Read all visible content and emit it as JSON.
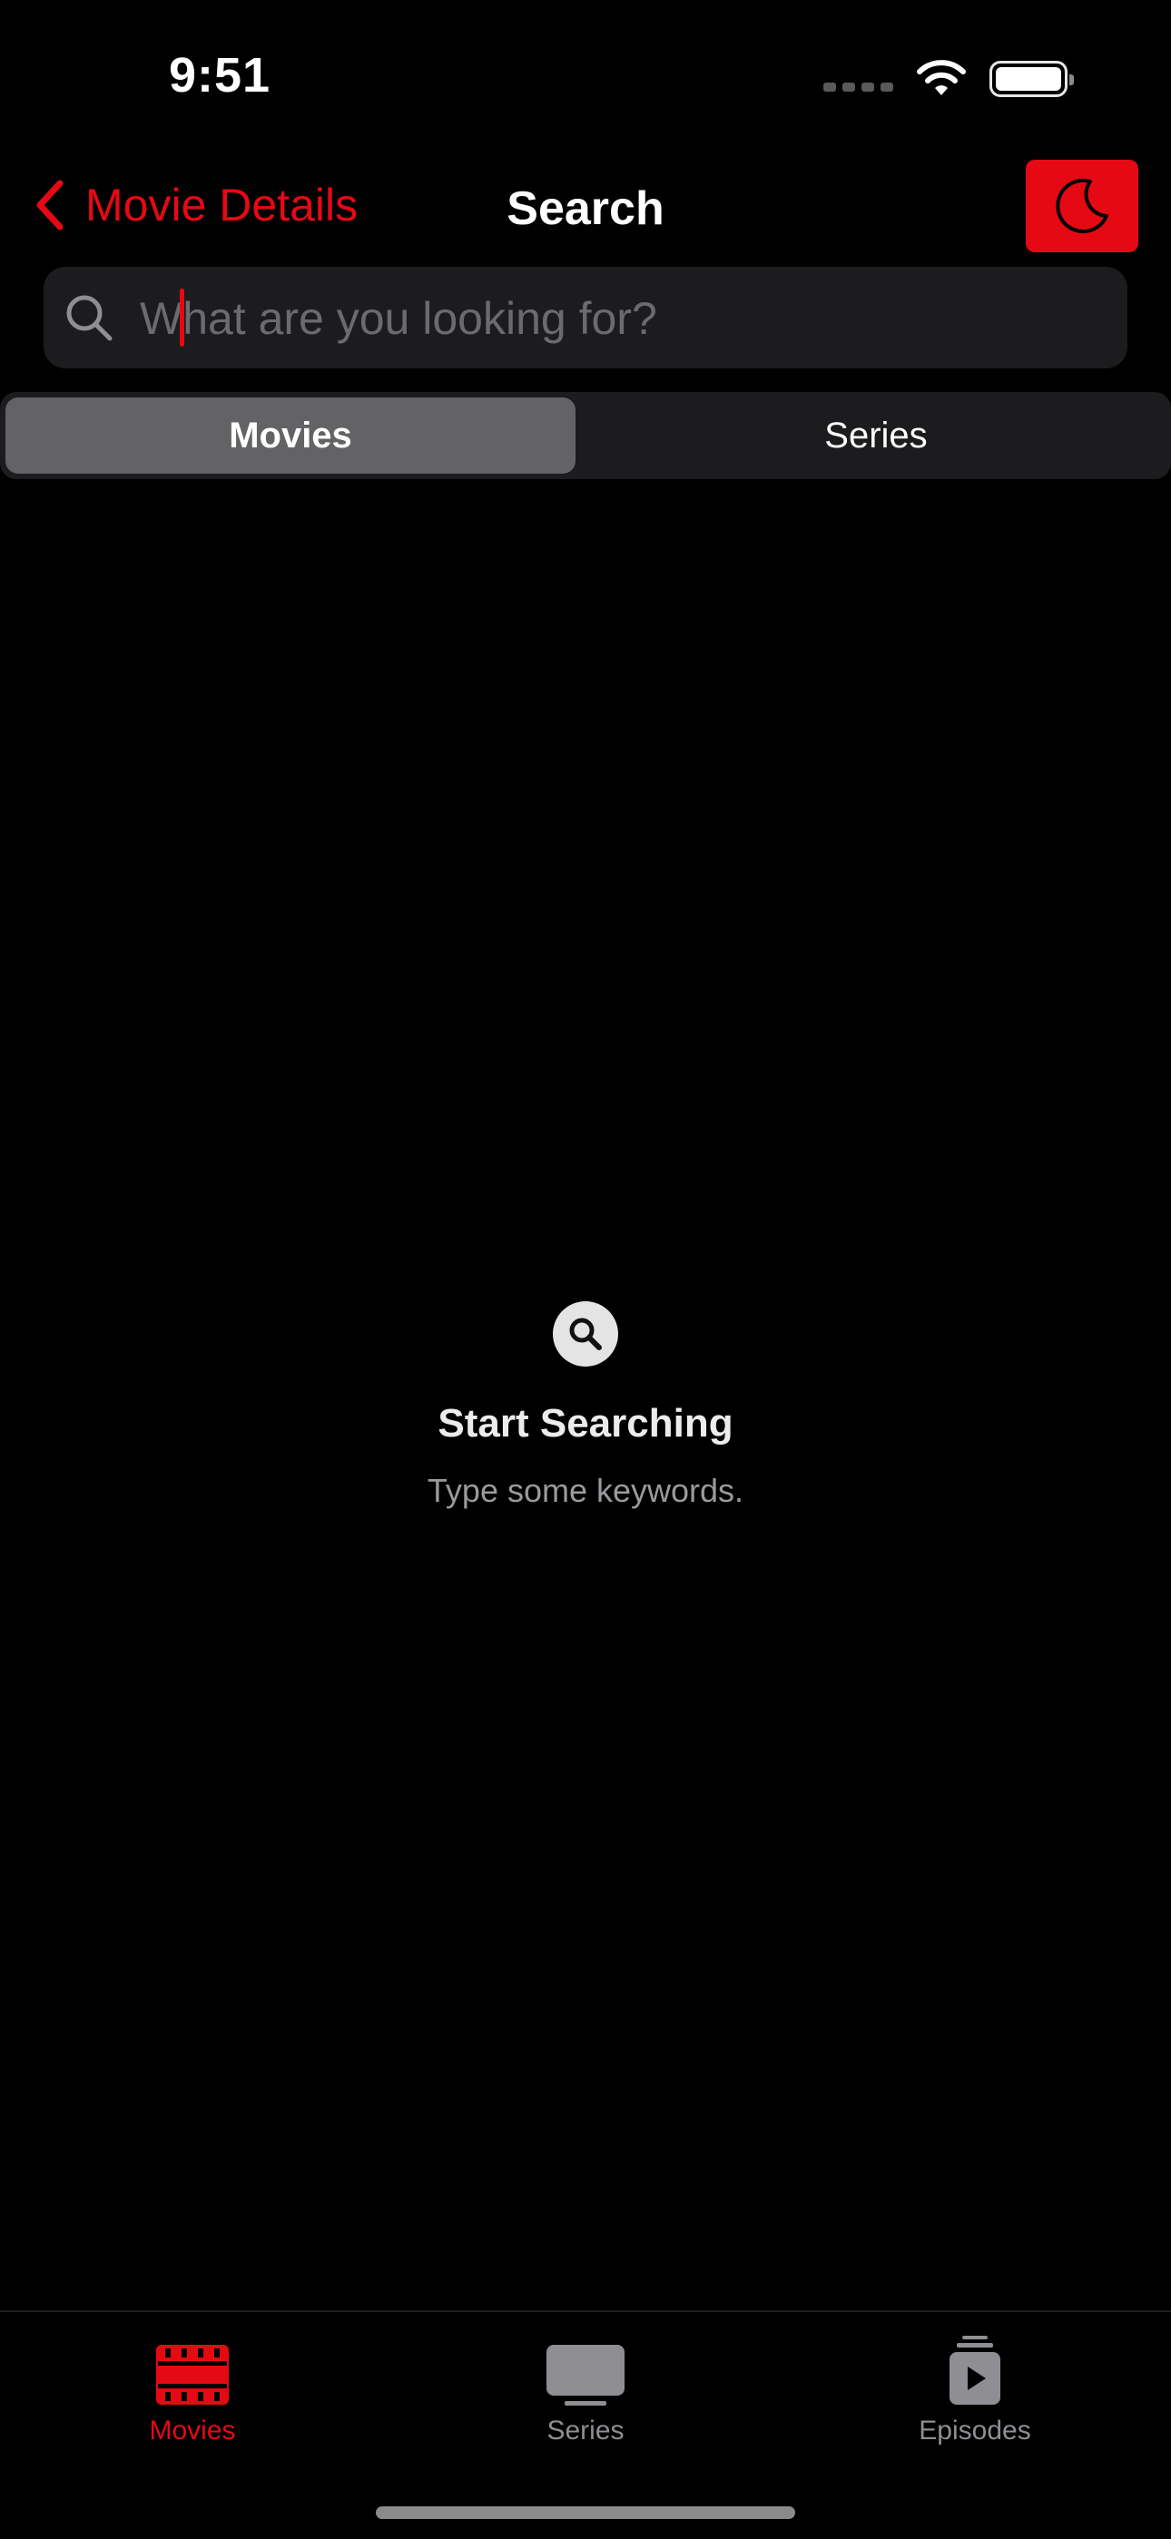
{
  "status_bar": {
    "time": "9:51"
  },
  "nav": {
    "back_label": "Movie Details",
    "title": "Search",
    "theme_icon": "moon-icon"
  },
  "search": {
    "placeholder": "What are you looking for?",
    "value": ""
  },
  "segments": {
    "items": [
      {
        "label": "Movies",
        "selected": true
      },
      {
        "label": "Series",
        "selected": false
      }
    ]
  },
  "empty_state": {
    "icon": "magnifier-icon",
    "title": "Start Searching",
    "subtitle": "Type some keywords."
  },
  "tab_bar": {
    "items": [
      {
        "label": "Movies",
        "icon": "film-icon",
        "active": true
      },
      {
        "label": "Series",
        "icon": "tv-icon",
        "active": false
      },
      {
        "label": "Episodes",
        "icon": "episodes-icon",
        "active": false
      }
    ]
  },
  "colors": {
    "accent": "#e50914",
    "background": "#000000",
    "field": "#1c1c1e",
    "segment_selected": "#636366",
    "inactive": "#8e8e93"
  }
}
